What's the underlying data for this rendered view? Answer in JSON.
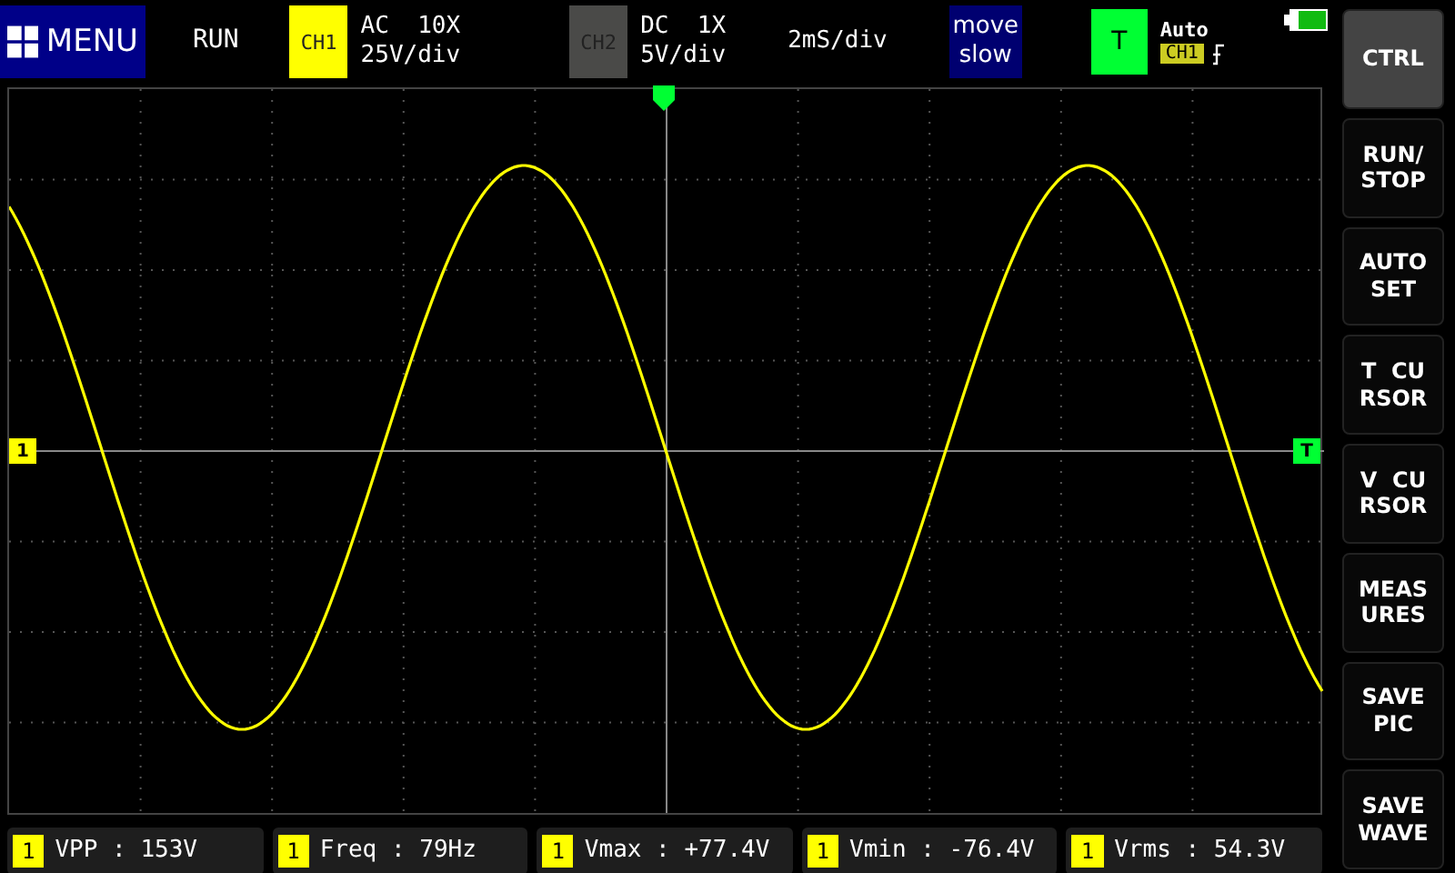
{
  "top_bar": {
    "menu": "MENU",
    "run_state": "RUN",
    "channels": [
      {
        "label": "CH1",
        "coupling": "AC  10X",
        "scale": "25V/div",
        "enabled": true
      },
      {
        "label": "CH2",
        "coupling": "DC  1X",
        "scale": "5V/div",
        "enabled": false
      }
    ],
    "timebase": "2mS/div",
    "move_speed": [
      "move",
      "slow"
    ],
    "trigger": {
      "label": "T",
      "mode": "Auto",
      "source": "CH1"
    }
  },
  "plot": {
    "channel_marker": "1",
    "trigger_marker": "T"
  },
  "side_buttons": [
    {
      "lines": [
        "CTRL"
      ],
      "kind": "ctrl"
    },
    {
      "lines": [
        "RUN/",
        "STOP"
      ],
      "kind": "normal"
    },
    {
      "lines": [
        "AUTO",
        "SET"
      ],
      "kind": "normal"
    },
    {
      "lines": [
        "T  CU",
        "RSOR"
      ],
      "kind": "normal"
    },
    {
      "lines": [
        "V  CU",
        "RSOR"
      ],
      "kind": "normal"
    },
    {
      "lines": [
        "MEAS",
        "URES"
      ],
      "kind": "normal"
    },
    {
      "lines": [
        "SAVE",
        "PIC"
      ],
      "kind": "normal"
    },
    {
      "lines": [
        "SAVE",
        "WAVE"
      ],
      "kind": "normal"
    }
  ],
  "measurements": [
    {
      "channel": "1",
      "text": "VPP : 153V"
    },
    {
      "channel": "1",
      "text": "Freq : 79Hz"
    },
    {
      "channel": "1",
      "text": "Vmax : +77.4V"
    },
    {
      "channel": "1",
      "text": "Vmin : -76.4V"
    },
    {
      "channel": "1",
      "text": "Vrms : 54.3V"
    }
  ]
}
